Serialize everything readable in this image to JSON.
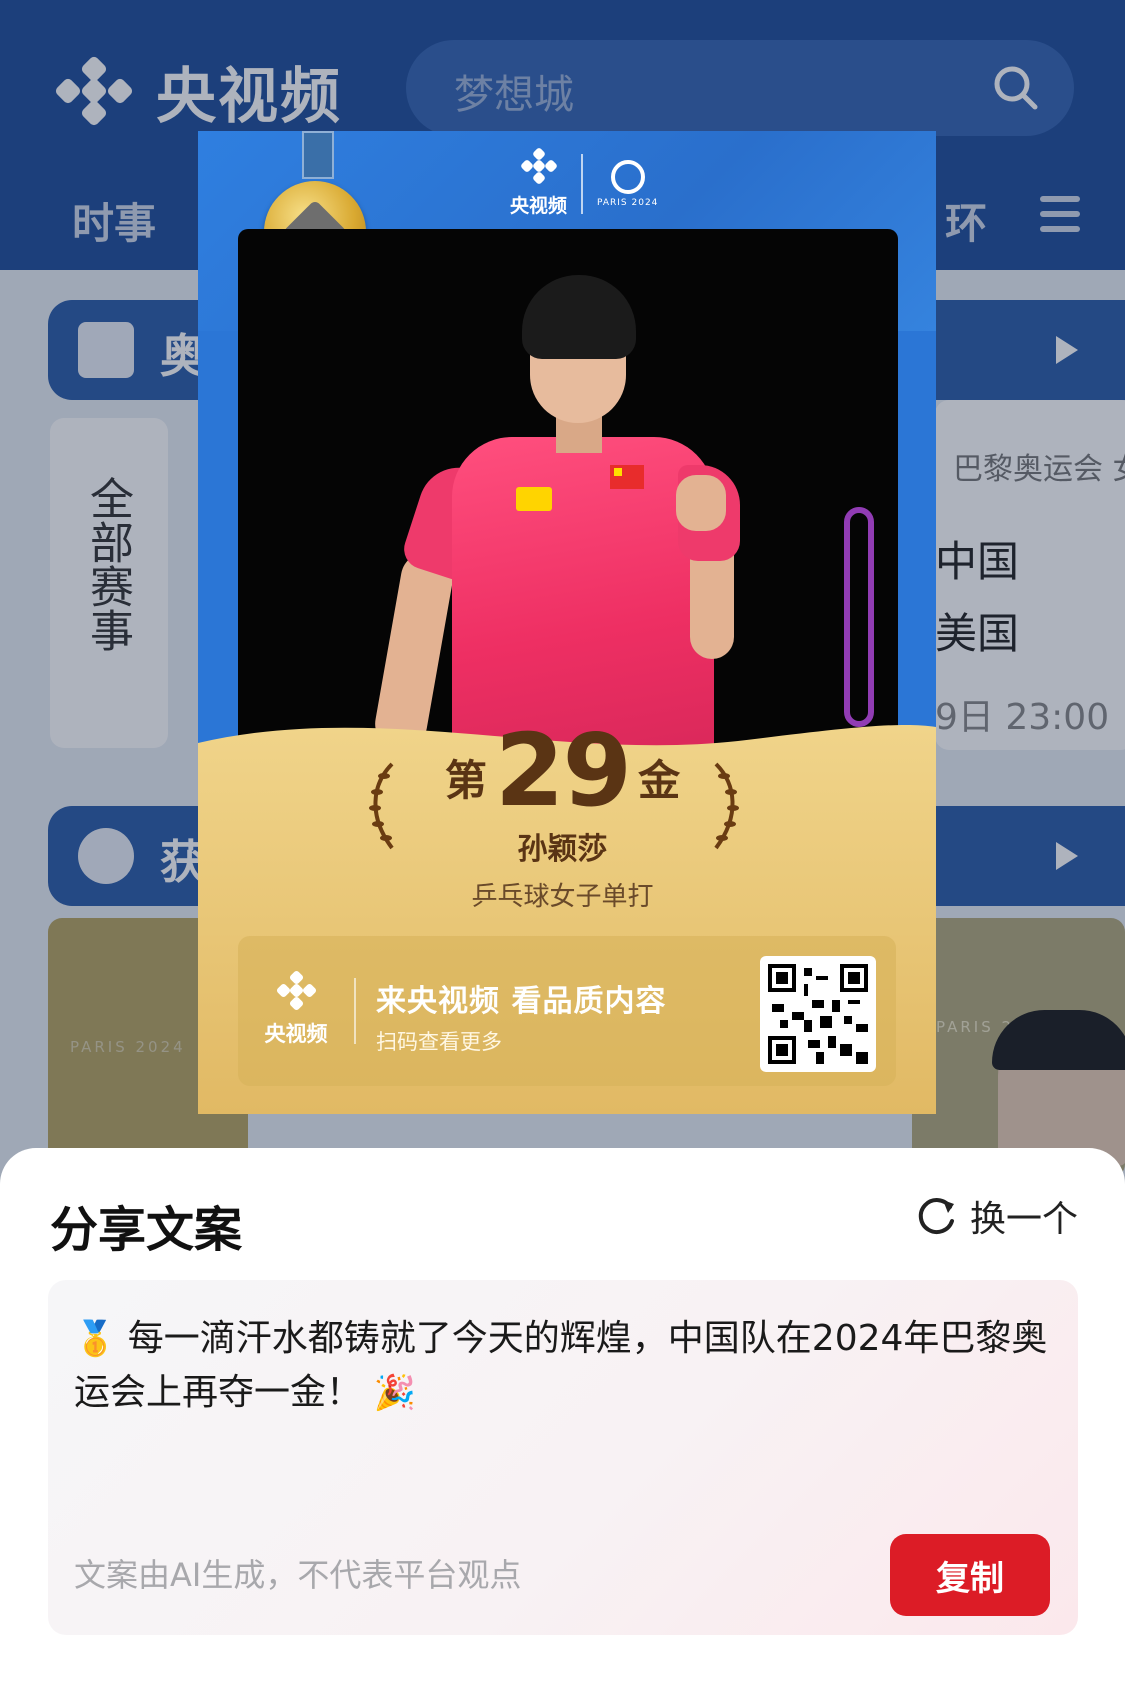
{
  "app": {
    "brand_name": "央视频",
    "search_placeholder": "梦想城",
    "tabs": {
      "left": "时事",
      "right": "环"
    },
    "sections": [
      {
        "label": "奥",
        "icon": "calendar-icon"
      },
      {
        "label": "获",
        "icon": "medal-icon"
      }
    ],
    "all_events_label": "全部赛事",
    "match_card": {
      "title": "巴黎奥运会 女",
      "team_a": "中国",
      "team_b": "美国",
      "time": "9日 23:00"
    },
    "paris_badge": "PARIS 2024"
  },
  "poster": {
    "brand_name": "央视频",
    "paris_text": "PARIS 2024",
    "rank_prefix": "第",
    "rank_number": "29",
    "rank_suffix": "金",
    "athlete": "孙颖莎",
    "event": "乒乓球女子单打",
    "promo_brand": "央视频",
    "promo_slogan": "来央视频 看品质内容",
    "promo_sub": "扫码查看更多"
  },
  "share_sheet": {
    "title": "分享文案",
    "refresh_label": "换一个",
    "copy_emoji_start": "🥇",
    "copy_text": "每一滴汗水都铸就了今天的辉煌，中国队在2024年巴黎奥运会上再夺一金！",
    "copy_emoji_end": "🎉",
    "disclaimer": "文案由AI生成，不代表平台观点",
    "copy_button": "复制"
  },
  "colors": {
    "header_blue": "#1f4d9a",
    "poster_blue": "#2b76d6",
    "gold": "#e3c070",
    "copy_red": "#dc1c26"
  }
}
